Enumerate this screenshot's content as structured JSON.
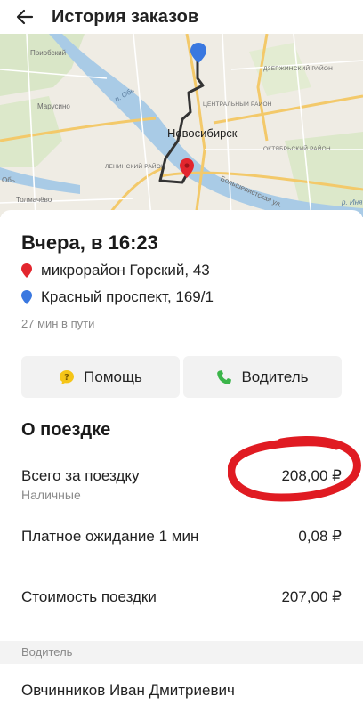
{
  "header": {
    "title": "История заказов",
    "back_icon": "arrow-left-icon"
  },
  "map": {
    "city": "Новосибирск",
    "labels": {
      "priobsky": "Приобский",
      "marusino": "Марусино",
      "ob": "Обь",
      "tolmachevo": "Толмачёво",
      "leninsky": "ЛЕНИНСКИЙ РАЙОН",
      "central": "ЦЕНТРАЛЬНЫЙ РАЙОН",
      "dzerzhinsky": "ДЗЕРЖИНСКИЙ РАЙОН",
      "oktyabrsky": "ОКТЯБРЬСКИЙ РАЙОН",
      "bolshevistskaya": "Большевистская ул.",
      "river_ob": "р. Обь",
      "river_inya": "р. Иня"
    },
    "route_color": "#333333",
    "start_pin_color": "#e3262e",
    "end_pin_color": "#3a78e0"
  },
  "trip": {
    "title": "Вчера, в 16:23",
    "from": "микрорайон Горский, 43",
    "to": "Красный проспект, 169/1",
    "duration": "27 мин в пути"
  },
  "actions": {
    "help_label": "Помощь",
    "help_icon": "question-icon",
    "driver_label": "Водитель",
    "driver_icon": "phone-icon"
  },
  "about": {
    "title": "О поездке",
    "total_label": "Всего за поездку",
    "total_value": "208,00 ₽",
    "payment_method": "Наличные",
    "waiting_label": "Платное ожидание 1 мин",
    "waiting_value": "0,08 ₽",
    "cost_label": "Стоимость поездки",
    "cost_value": "207,00 ₽"
  },
  "driver": {
    "section_label": "Водитель",
    "name": "Овчинников Иван Дмитриевич"
  },
  "colors": {
    "annotation": "#e01b22",
    "help_icon": "#f5c518",
    "phone_icon": "#3bb54a"
  }
}
